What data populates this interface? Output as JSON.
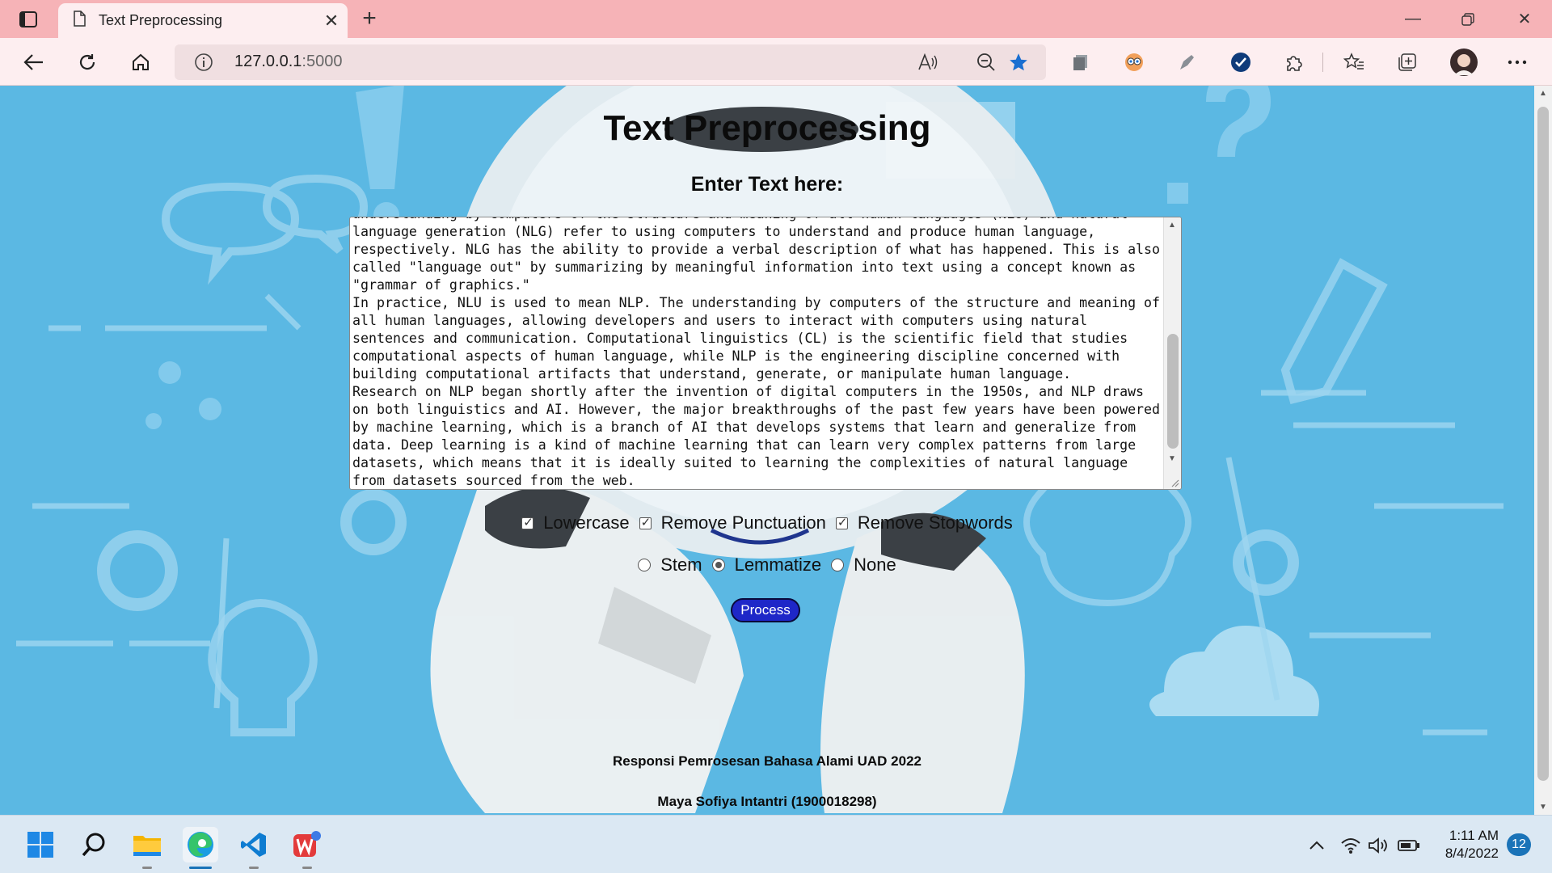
{
  "browser": {
    "tab_title": "Text Preprocessing",
    "url_host": "127.0.0.1",
    "url_port": ":5000"
  },
  "page": {
    "title": "Text Preprocessing",
    "subtitle": "Enter Text here:",
    "textarea_value": "understanding by computers of the structure and meaning of all human languages (NLU) and natural language generation (NLG) refer to using computers to understand and produce human language, respectively. NLG has the ability to provide a verbal description of what has happened. This is also called \"language out\" by summarizing by meaningful information into text using a concept known as \"grammar of graphics.\"\nIn practice, NLU is used to mean NLP. The understanding by computers of the structure and meaning of all human languages, allowing developers and users to interact with computers using natural sentences and communication. Computational linguistics (CL) is the scientific field that studies computational aspects of human language, while NLP is the engineering discipline concerned with building computational artifacts that understand, generate, or manipulate human language.\nResearch on NLP began shortly after the invention of digital computers in the 1950s, and NLP draws on both linguistics and AI. However, the major breakthroughs of the past few years have been powered by machine learning, which is a branch of AI that develops systems that learn and generalize from data. Deep learning is a kind of machine learning that can learn very complex patterns from large datasets, which means that it is ideally suited to learning the complexities of natural language from datasets sourced from the web.",
    "checkboxes": [
      {
        "label": "Lowercase",
        "checked": true
      },
      {
        "label": "Remove Punctuation",
        "checked": true
      },
      {
        "label": "Remove Stopwords",
        "checked": true
      }
    ],
    "radios": [
      {
        "label": "Stem",
        "checked": false
      },
      {
        "label": "Lemmatize",
        "checked": true
      },
      {
        "label": "None",
        "checked": false
      }
    ],
    "process_button": "Process",
    "footer_line1": "Responsi Pemrosesan Bahasa Alami UAD 2022",
    "footer_line2": "Maya Sofiya Intantri (1900018298)"
  },
  "taskbar": {
    "apps": [
      "start-icon",
      "search-icon",
      "file-explorer-icon",
      "edge-icon",
      "vscode-icon",
      "wps-office-icon"
    ],
    "time": "1:11 AM",
    "date": "8/4/2022",
    "notification_count": "12"
  },
  "colors": {
    "page_bg": "#5bb8e3",
    "tab_strip": "#f6b3b7",
    "toolbar": "#fdeef0",
    "button": "#1e27c8"
  }
}
